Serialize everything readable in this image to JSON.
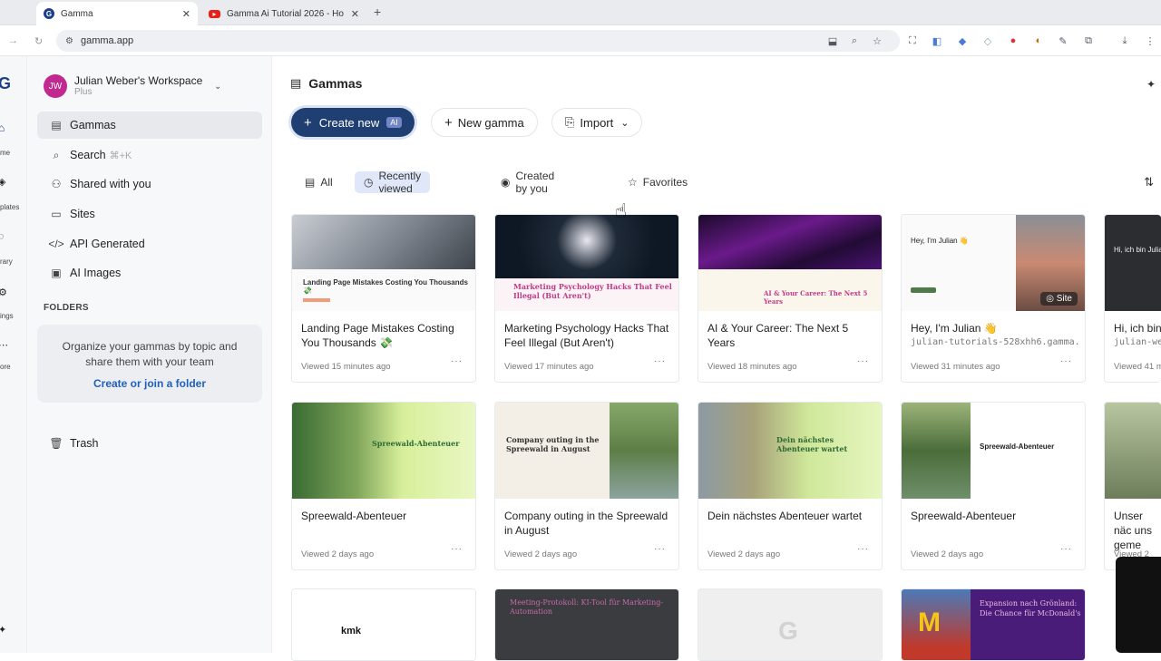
{
  "browser": {
    "tabs": [
      {
        "title": "Gamma",
        "favicon": "G"
      },
      {
        "title": "Gamma Ai Tutorial 2026 - Ho",
        "favicon": "yt"
      }
    ],
    "new_tab": "+",
    "url": "gamma.app"
  },
  "rail": {
    "items": [
      "me",
      "plates",
      "rary",
      "ings",
      "ore"
    ]
  },
  "sidebar": {
    "workspace_initials": "JW",
    "workspace_name": "Julian Weber's Workspace",
    "workspace_plan": "Plus",
    "nav": [
      {
        "label": "Gammas",
        "icon": "stack-icon"
      },
      {
        "label": "Search",
        "shortcut": "⌘+K",
        "icon": "search-icon"
      },
      {
        "label": "Shared with you",
        "icon": "people-icon"
      },
      {
        "label": "Sites",
        "icon": "globe-icon"
      },
      {
        "label": "API Generated",
        "icon": "code-icon"
      },
      {
        "label": "AI Images",
        "icon": "image-icon"
      }
    ],
    "folders_heading": "FOLDERS",
    "folders_text": "Organize your gammas by topic and share them with your team",
    "folders_link": "Create or join a folder",
    "trash": "Trash"
  },
  "main": {
    "title": "Gammas",
    "create_new": "Create new",
    "ai_badge": "AI",
    "new_gamma": "New gamma",
    "import": "Import",
    "filters": [
      "All",
      "Recently viewed",
      "Created by you",
      "Favorites"
    ],
    "cards": [
      {
        "title": "Landing Page Mistakes Costing You Thousands 💸",
        "viewed": "Viewed 15 minutes ago",
        "thumb_text": "Landing Page Mistakes Costing You Thousands 💸"
      },
      {
        "title": "Marketing Psychology Hacks That Feel Illegal (But Aren't)",
        "viewed": "Viewed 17 minutes ago",
        "thumb_text": "Marketing Psychology Hacks That Feel Illegal (But Aren't)"
      },
      {
        "title": "AI & Your Career: The Next 5 Years",
        "viewed": "Viewed 18 minutes ago",
        "thumb_text": "AI & Your Career: The Next 5 Years"
      },
      {
        "title": "Hey, I'm Julian 👋",
        "subtitle": "julian-tutorials-528xhh6.gamma.…",
        "viewed": "Viewed 31 minutes ago",
        "badge": "Site",
        "thumb_text": "Hey, I'm Julian 👋"
      },
      {
        "title": "Hi, ich bin",
        "subtitle": "julian-we",
        "viewed": "Viewed 41 m",
        "thumb_text": "Hi, ich bin Julia"
      },
      {
        "title": "Spreewald-Abenteuer",
        "viewed": "Viewed 2 days ago",
        "thumb_text": "Spreewald-Abenteuer"
      },
      {
        "title": "Company outing in the Spreewald in August",
        "viewed": "Viewed 2 days ago",
        "thumb_text": "Company outing in the Spreewald in August"
      },
      {
        "title": "Dein nächstes Abenteuer wartet",
        "viewed": "Viewed 2 days ago",
        "thumb_text": "Dein nächstes Abenteuer wartet"
      },
      {
        "title": "Spreewald-Abenteuer",
        "viewed": "Viewed 2 days ago",
        "thumb_text": "Spreewald-Abenteuer"
      },
      {
        "title": "Unser näc uns geme",
        "viewed": "Viewed 2",
        "thumb_text": ""
      },
      {
        "title": "",
        "viewed": "",
        "thumb_text": "kmk"
      },
      {
        "title": "",
        "viewed": "",
        "thumb_text": "Meeting-Protokoll: KI-Tool für Marketing-Automation"
      },
      {
        "title": "",
        "viewed": "",
        "thumb_text": "G"
      },
      {
        "title": "",
        "viewed": "",
        "thumb_text": "Expansion nach Grönland: Die Chance für McDonald's"
      }
    ],
    "dots": "···"
  }
}
